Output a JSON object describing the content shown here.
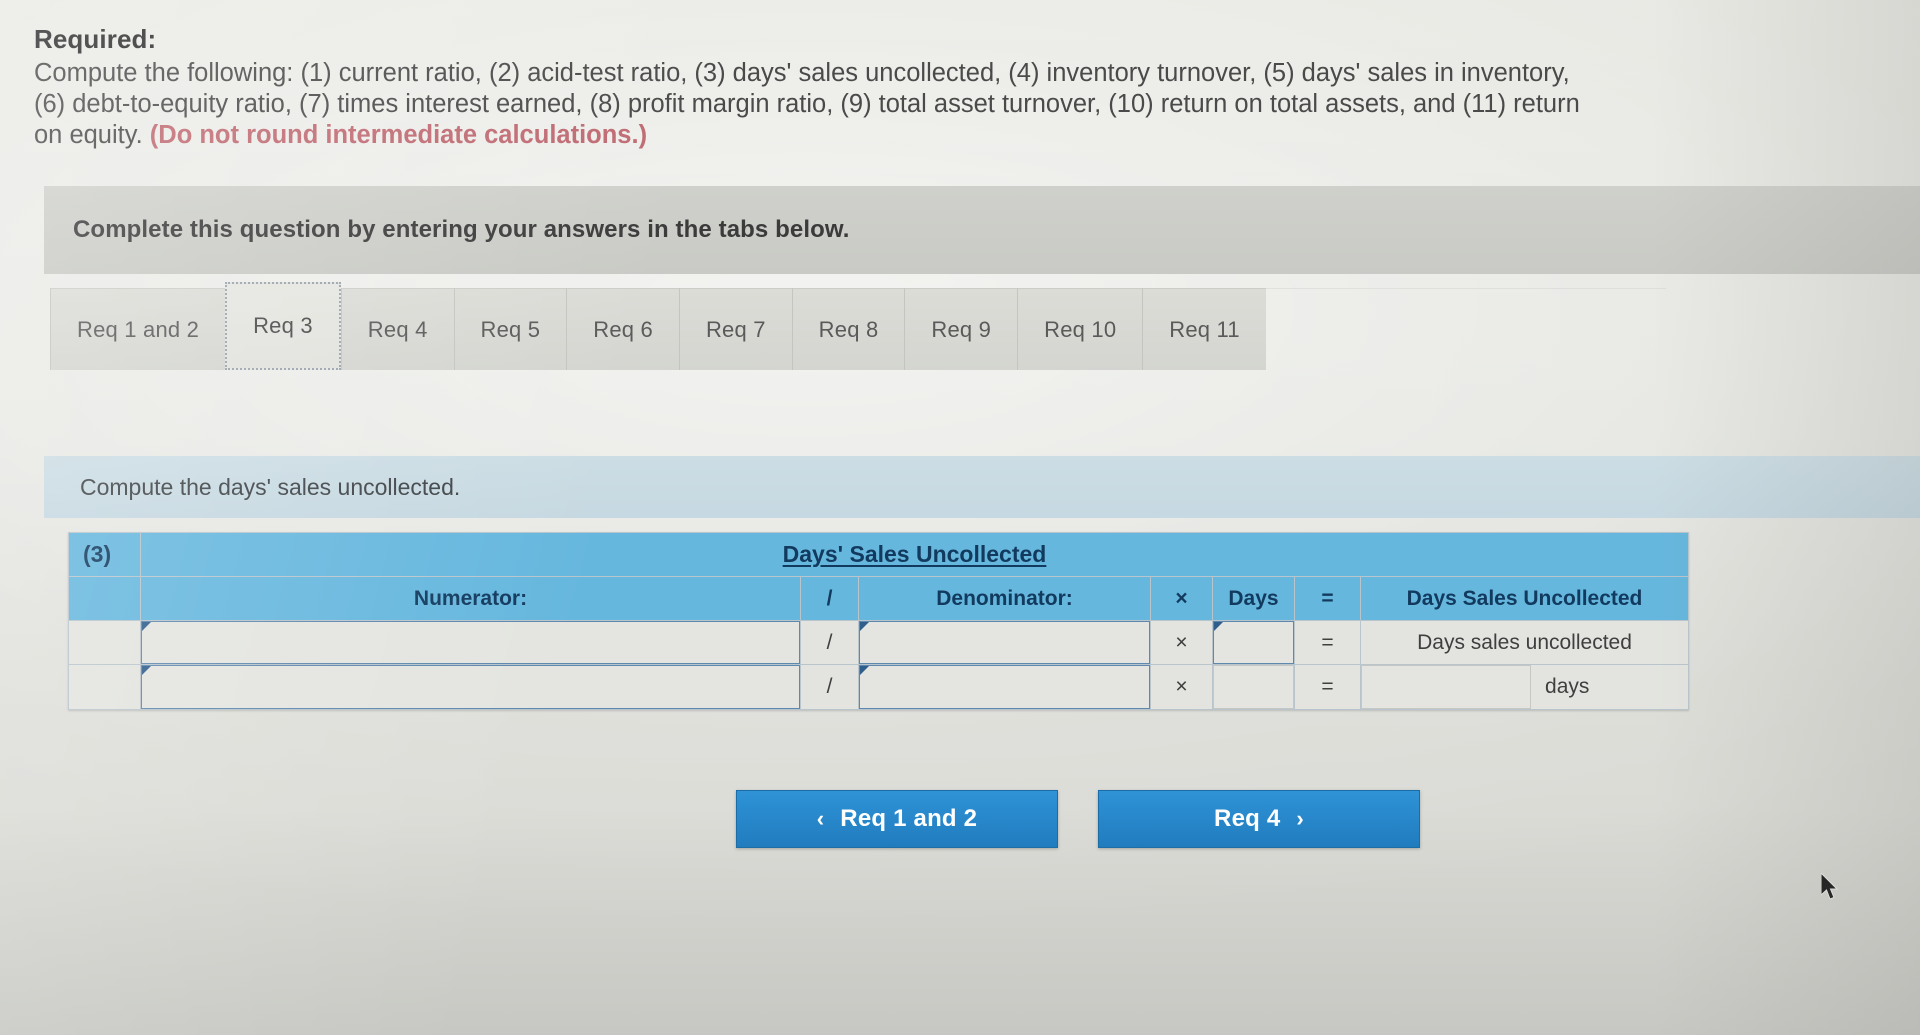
{
  "required": {
    "label": "Required:",
    "line1": "Compute the following: (1) current ratio, (2) acid-test ratio, (3) days' sales uncollected, (4) inventory turnover, (5) days' sales in inventory,",
    "line2": "(6) debt-to-equity ratio, (7) times interest earned, (8) profit margin ratio, (9) total asset turnover, (10) return on total assets, and (11) return",
    "line3_plain": "on equity. ",
    "line3_note": "(Do not round intermediate calculations.)",
    "note_color": "#c06a72"
  },
  "instruction": {
    "text": "Complete this question by entering your answers in the tabs below."
  },
  "tabs": {
    "active_index": 1,
    "items": [
      {
        "label": "Req 1 and 2"
      },
      {
        "label": "Req 3"
      },
      {
        "label": "Req 4"
      },
      {
        "label": "Req 5"
      },
      {
        "label": "Req 6"
      },
      {
        "label": "Req 7"
      },
      {
        "label": "Req 8"
      },
      {
        "label": "Req 9"
      },
      {
        "label": "Req 10"
      },
      {
        "label": "Req 11"
      }
    ]
  },
  "sub_instruction": {
    "text": "Compute the days' sales uncollected."
  },
  "answer_table": {
    "row_number": "(3)",
    "title": "Days' Sales Uncollected",
    "columns": {
      "numerator": "Numerator:",
      "divide": "/",
      "denominator": "Denominator:",
      "times": "×",
      "days": "Days",
      "equals": "=",
      "result": "Days Sales Uncollected"
    },
    "rows": [
      {
        "label": "",
        "numerator_value": "",
        "divide": "/",
        "denominator_value": "",
        "times": "×",
        "days_value": "",
        "equals": "=",
        "result_text": "Days sales uncollected"
      },
      {
        "label": "",
        "numerator_value": "",
        "divide": "/",
        "denominator_value": "",
        "times": "×",
        "days_value": "",
        "equals": "=",
        "result_text": "",
        "result_units": "days"
      }
    ]
  },
  "navigation": {
    "prev_label": "Req 1 and 2",
    "prev_chevron": "‹",
    "next_label": "Req 4",
    "next_chevron": "›",
    "button_color": "#2f93d6"
  },
  "theme": {
    "header_blue": "#66b7de",
    "header_text": "#123a5e",
    "panel_grey": "#cfd0cb",
    "sub_instruction_blue": "#ccdde4"
  }
}
